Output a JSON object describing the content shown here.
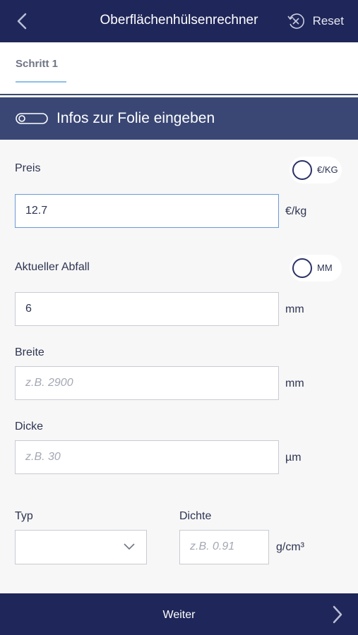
{
  "header": {
    "title": "Oberflächenhülsenrechner",
    "reset_label": "Reset"
  },
  "tabs": [
    {
      "label": "Schritt 1"
    }
  ],
  "section": {
    "title": "Infos zur Folie eingeben"
  },
  "fields": {
    "preis": {
      "label": "Preis",
      "value": "12.7",
      "unit": "€/kg",
      "radio_label": "€/KG"
    },
    "abfall": {
      "label": "Aktueller Abfall",
      "value": "6",
      "unit": "mm",
      "radio_label": "MM"
    },
    "breite": {
      "label": "Breite",
      "placeholder": "z.B. 2900",
      "unit": "mm"
    },
    "dicke": {
      "label": "Dicke",
      "placeholder": "z.B. 30",
      "unit": "µm"
    },
    "typ": {
      "label": "Typ",
      "value": ""
    },
    "dichte": {
      "label": "Dichte",
      "placeholder": "z.B. 0.91",
      "unit": "g/cm³"
    }
  },
  "footer": {
    "next_label": "Weiter"
  },
  "icons": {
    "back": "chevron-left-icon",
    "reset": "reset-icon",
    "toggle": "toggle-icon",
    "dropdown": "chevron-down-icon",
    "forward": "chevron-right-icon"
  },
  "colors": {
    "nav_bg": "#1f2659",
    "section_bg": "#3a4775",
    "accent": "#8ebfe8"
  }
}
